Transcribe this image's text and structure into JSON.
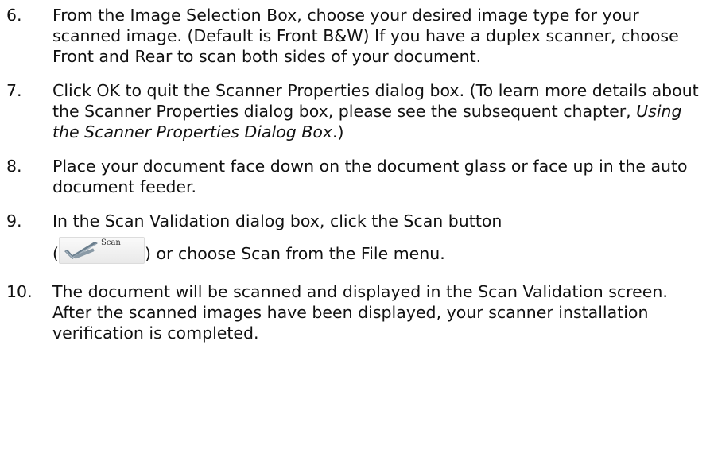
{
  "steps": [
    {
      "number": "6.",
      "text": "From the Image Selection Box, choose your desired image type for your scanned image.  (Default is Front B&W)  If you have a duplex scanner, choose Front and Rear to scan both sides of your document."
    },
    {
      "number": "7.",
      "text_before": "Click OK to quit the Scanner Properties dialog box.  (To learn more details about the Scanner Properties dialog box, please see the subsequent chapter, ",
      "text_italic": "Using the Scanner Properties Dialog Box",
      "text_after": ".)"
    },
    {
      "number": "8.",
      "text": "Place your document face down on the document glass or face up in the auto document feeder."
    },
    {
      "number": "9.",
      "text_line1": "In the Scan Validation dialog box, click the Scan button",
      "paren_open": "(",
      "text_line2": ") or choose Scan from the File menu.",
      "scan_button": {
        "label": "Scan",
        "icon": "scanner-check-icon"
      }
    },
    {
      "number": "10.",
      "text": "The document will be scanned and displayed in the Scan Validation screen.  After the scanned images have been displayed, your scanner installation verification is completed."
    }
  ]
}
